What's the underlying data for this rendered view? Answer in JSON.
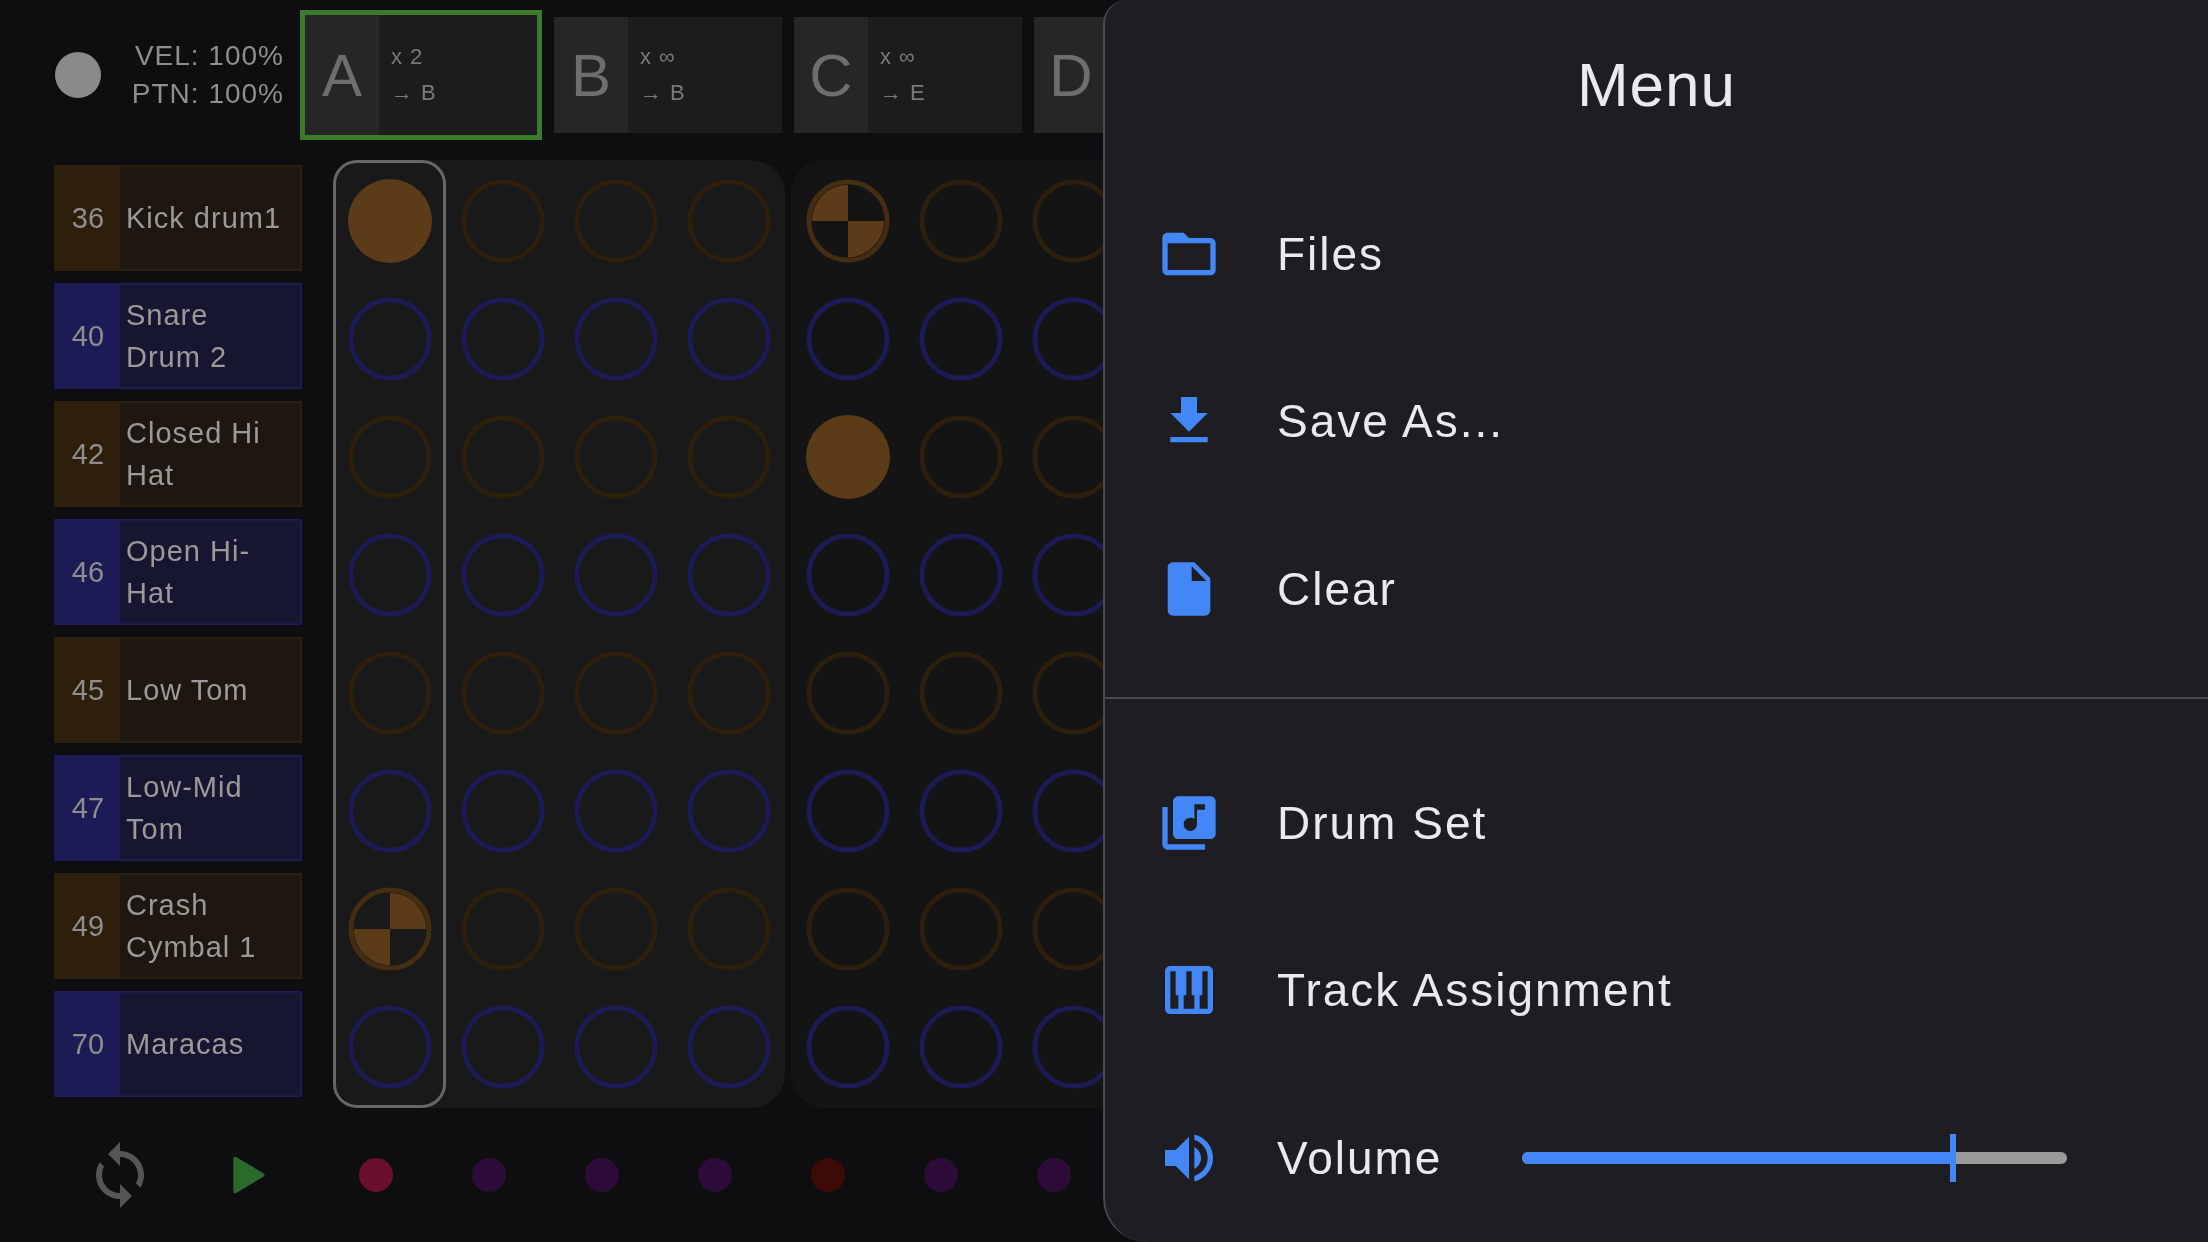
{
  "status": {
    "velocity": "VEL: 100%",
    "pattern": "PTN: 100%"
  },
  "patterns": [
    {
      "letter": "A",
      "repeat": "x 2",
      "next": "→ B",
      "selected": true
    },
    {
      "letter": "B",
      "repeat": "x ∞",
      "next": "→ B",
      "selected": false
    },
    {
      "letter": "C",
      "repeat": "x ∞",
      "next": "→ E",
      "selected": false
    },
    {
      "letter": "D",
      "selected": false
    }
  ],
  "tracks": [
    {
      "number": "36",
      "name": "Kick drum1",
      "color": "#2e1e0c"
    },
    {
      "number": "40",
      "name": "Snare Drum 2",
      "color": "#1d1b55"
    },
    {
      "number": "42",
      "name": "Closed Hi Hat",
      "color": "#2e1e0c"
    },
    {
      "number": "46",
      "name": "Open Hi-Hat",
      "color": "#1d1b55"
    },
    {
      "number": "45",
      "name": "Low Tom",
      "color": "#2e1e0c"
    },
    {
      "number": "47",
      "name": "Low-Mid Tom",
      "color": "#1d1b55"
    },
    {
      "number": "49",
      "name": "Crash Cymbal 1",
      "color": "#2e1e0c"
    },
    {
      "number": "70",
      "name": "Maracas",
      "color": "#1d1b55"
    }
  ],
  "steps": [
    {
      "selected": true,
      "cells": [
        {
          "kind": "on"
        },
        {
          "kind": "off"
        },
        {
          "kind": "off"
        },
        {
          "kind": "off"
        },
        {
          "kind": "off"
        },
        {
          "kind": "off"
        },
        {
          "kind": "checker_alt"
        },
        {
          "kind": "off"
        }
      ]
    },
    {
      "selected": false,
      "cells": [
        {
          "kind": "off"
        },
        {
          "kind": "off"
        },
        {
          "kind": "off"
        },
        {
          "kind": "off"
        },
        {
          "kind": "off"
        },
        {
          "kind": "off"
        },
        {
          "kind": "off"
        },
        {
          "kind": "off"
        }
      ]
    },
    {
      "selected": false,
      "cells": [
        {
          "kind": "off"
        },
        {
          "kind": "off"
        },
        {
          "kind": "off"
        },
        {
          "kind": "off"
        },
        {
          "kind": "off"
        },
        {
          "kind": "off"
        },
        {
          "kind": "off"
        },
        {
          "kind": "off"
        }
      ]
    },
    {
      "selected": false,
      "cells": [
        {
          "kind": "off"
        },
        {
          "kind": "off"
        },
        {
          "kind": "off"
        },
        {
          "kind": "off"
        },
        {
          "kind": "off"
        },
        {
          "kind": "off"
        },
        {
          "kind": "off"
        },
        {
          "kind": "off"
        }
      ]
    },
    {
      "selected": false,
      "cells": [
        {
          "kind": "checker"
        },
        {
          "kind": "off"
        },
        {
          "kind": "on"
        },
        {
          "kind": "off"
        },
        {
          "kind": "off"
        },
        {
          "kind": "off"
        },
        {
          "kind": "off"
        },
        {
          "kind": "off"
        }
      ]
    },
    {
      "selected": false,
      "cells": [
        {
          "kind": "off"
        },
        {
          "kind": "off"
        },
        {
          "kind": "off"
        },
        {
          "kind": "off"
        },
        {
          "kind": "off"
        },
        {
          "kind": "off"
        },
        {
          "kind": "off"
        },
        {
          "kind": "off"
        }
      ]
    },
    {
      "selected": false,
      "cells": [
        {
          "kind": "off"
        },
        {
          "kind": "off"
        },
        {
          "kind": "off"
        },
        {
          "kind": "off"
        },
        {
          "kind": "off"
        },
        {
          "kind": "off"
        },
        {
          "kind": "off"
        },
        {
          "kind": "off"
        }
      ]
    }
  ],
  "step_indicators": [
    {
      "color": "#6a0f2e"
    },
    {
      "color": "#2d0c3a"
    },
    {
      "color": "#2d0c3a"
    },
    {
      "color": "#2d0c3a"
    },
    {
      "color": "#3e0a05"
    },
    {
      "color": "#2d0c3a"
    },
    {
      "color": "#2d0c3a"
    }
  ],
  "menu": {
    "title": "Menu",
    "items": [
      {
        "kind": "folder",
        "label": "Files"
      },
      {
        "kind": "download",
        "label": "Save As..."
      },
      {
        "kind": "file",
        "label": "Clear"
      },
      {
        "kind": "divider"
      },
      {
        "kind": "music",
        "label": "Drum Set"
      },
      {
        "kind": "piano",
        "label": "Track Assignment"
      },
      {
        "kind": "volume",
        "label": "Volume",
        "level": 0.79
      }
    ]
  }
}
